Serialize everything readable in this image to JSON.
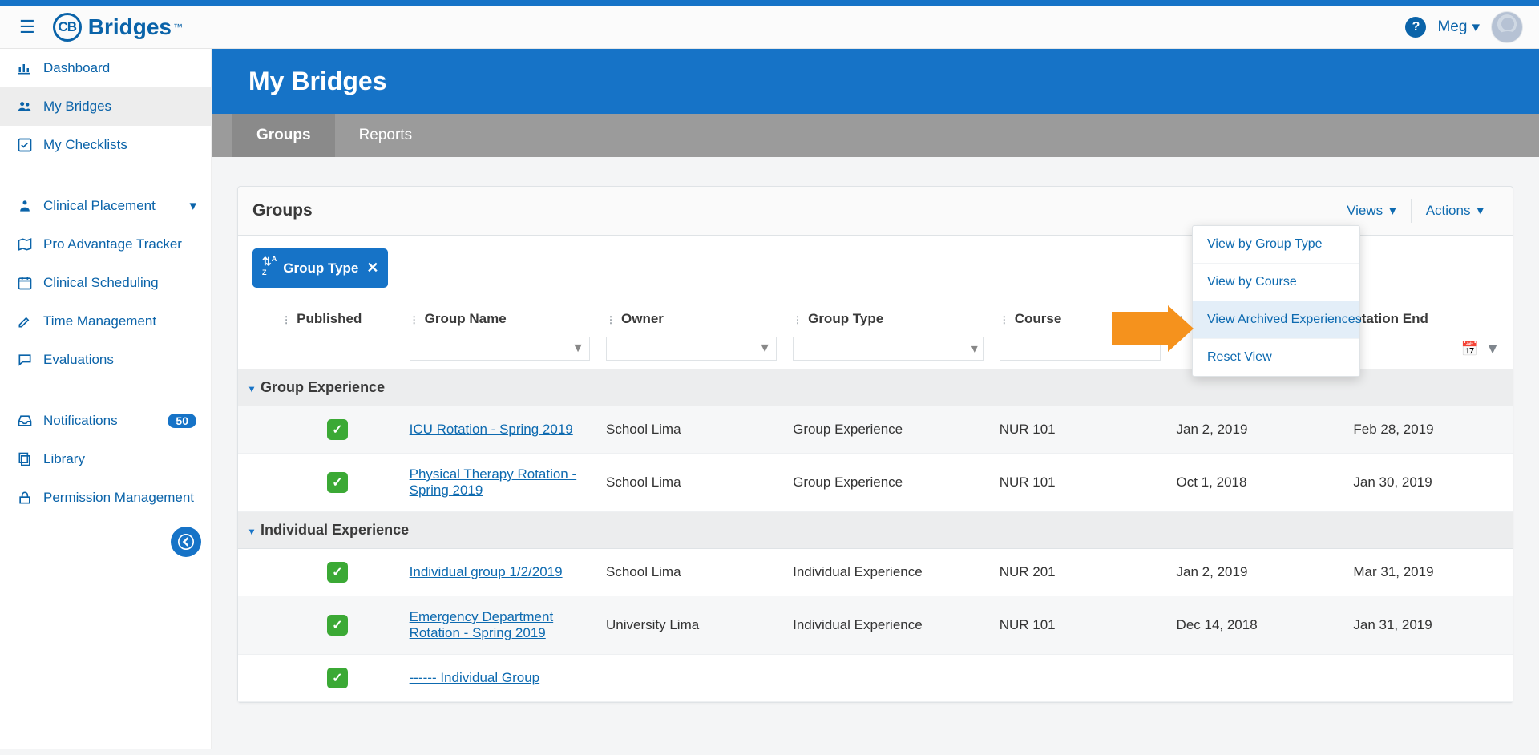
{
  "brand": {
    "name": "Bridges",
    "tm": "™"
  },
  "user": {
    "name": "Meg"
  },
  "sidebar": {
    "items": [
      {
        "label": "Dashboard"
      },
      {
        "label": "My Bridges"
      },
      {
        "label": "My Checklists"
      },
      {
        "label": "Clinical Placement"
      },
      {
        "label": "Pro Advantage Tracker"
      },
      {
        "label": "Clinical Scheduling"
      },
      {
        "label": "Time Management"
      },
      {
        "label": "Evaluations"
      },
      {
        "label": "Notifications",
        "badge": "50"
      },
      {
        "label": "Library"
      },
      {
        "label": "Permission Management"
      }
    ]
  },
  "page": {
    "title": "My Bridges"
  },
  "tabs": [
    {
      "label": "Groups",
      "active": true
    },
    {
      "label": "Reports",
      "active": false
    }
  ],
  "panel": {
    "title": "Groups",
    "views_label": "Views",
    "actions_label": "Actions",
    "chip_label": "Group Type",
    "columns": {
      "published": "Published",
      "group_name": "Group Name",
      "owner": "Owner",
      "group_type": "Group Type",
      "course": "Course",
      "rotation_end_partial": "otation End"
    }
  },
  "views_menu": [
    "View by Group Type",
    "View by Course",
    "View Archived Experiences",
    "Reset View"
  ],
  "groups": [
    {
      "title": "Group Experience",
      "rows": [
        {
          "published": true,
          "name": "ICU Rotation - Spring 2019",
          "owner": "School Lima",
          "type": "Group Experience",
          "course": "NUR 101",
          "start": "Jan 2, 2019",
          "end": "Feb 28, 2019"
        },
        {
          "published": true,
          "name": "Physical Therapy Rotation - Spring 2019",
          "owner": "School Lima",
          "type": "Group Experience",
          "course": "NUR 101",
          "start": "Oct 1, 2018",
          "end": "Jan 30, 2019"
        }
      ]
    },
    {
      "title": "Individual Experience",
      "rows": [
        {
          "published": true,
          "name": "Individual group 1/2/2019",
          "owner": "School Lima",
          "type": "Individual Experience",
          "course": "NUR 201",
          "start": "Jan 2, 2019",
          "end": "Mar 31, 2019"
        },
        {
          "published": true,
          "name": "Emergency Department Rotation - Spring 2019",
          "owner": "University Lima",
          "type": "Individual Experience",
          "course": "NUR 101",
          "start": "Dec 14, 2018",
          "end": "Jan 31, 2019"
        },
        {
          "published": true,
          "name": "------ Individual Group",
          "owner": "",
          "type": "",
          "course": "",
          "start": "",
          "end": ""
        }
      ]
    }
  ]
}
